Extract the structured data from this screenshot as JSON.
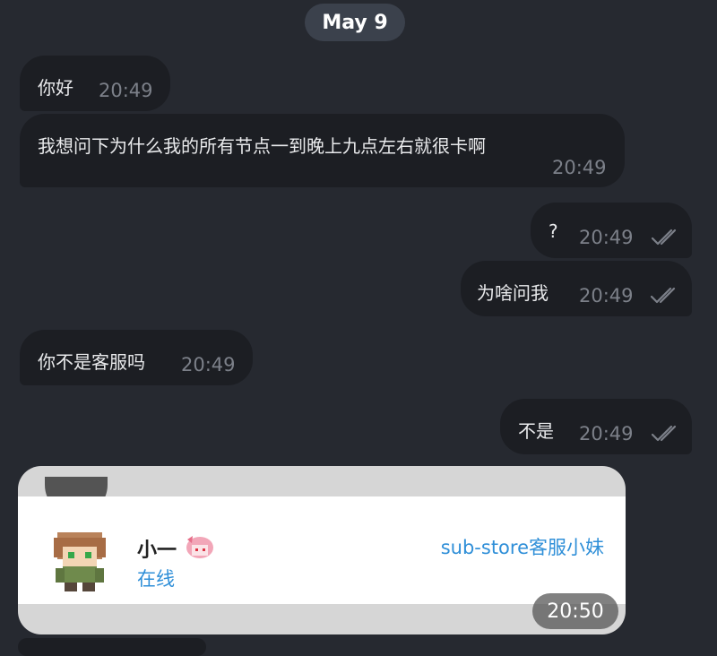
{
  "date_label": "May 9",
  "messages": [
    {
      "text": "你好",
      "time": "20:49"
    },
    {
      "text": "我想问下为什么我的所有节点一到晚上九点左右就很卡啊",
      "time": "20:49"
    },
    {
      "text": "?",
      "time": "20:49",
      "read": true
    },
    {
      "text": "为啥问我",
      "time": "20:49",
      "read": true
    },
    {
      "text": "你不是客服吗",
      "time": "20:49"
    },
    {
      "text": "不是",
      "time": "20:49",
      "read": true
    }
  ],
  "image_message": {
    "name": "小一",
    "status": "在线",
    "service": "sub-store客服小妹",
    "time": "20:50"
  },
  "colors": {
    "background": "#262930",
    "bubble": "#1c1e23",
    "timestamp": "#7c8089",
    "link": "#2f8fd8"
  }
}
